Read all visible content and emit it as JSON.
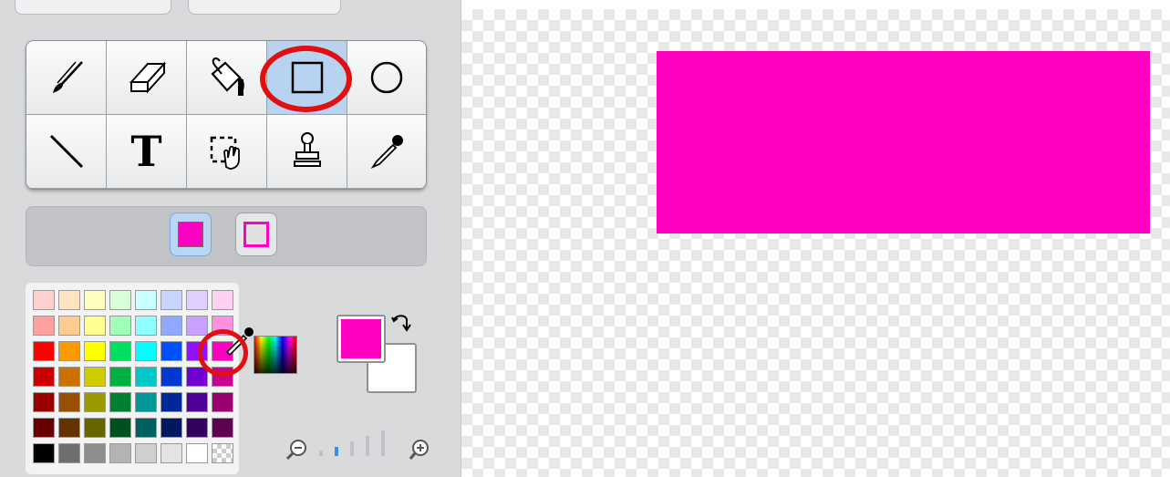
{
  "colors": {
    "fill": "#ff00c0",
    "secondary": "#ffffff",
    "panel": "#d9dadc",
    "annotation": "#e01010",
    "selected_tool": "#b8d3ef"
  },
  "tools": [
    [
      "brush-icon",
      "eraser-icon",
      "fill-bucket-icon",
      "rectangle-icon",
      "ellipse-icon"
    ],
    [
      "line-icon",
      "text-icon",
      "select-icon",
      "stamp-icon",
      "eyedropper-icon"
    ]
  ],
  "selected_tool": "rectangle-icon",
  "text_tool_label": "T",
  "fill_mode": {
    "selected": "solid",
    "options": [
      "solid",
      "outline"
    ]
  },
  "palette": [
    [
      "#ffd0d0",
      "#ffe4c0",
      "#ffffc0",
      "#d8ffd8",
      "#c8ffff",
      "#c8d4ff",
      "#e0d0ff",
      "#ffd0f0"
    ],
    [
      "#ffa0a0",
      "#ffcc90",
      "#ffff90",
      "#a0ffb8",
      "#90ffff",
      "#90a8ff",
      "#c8a0ff",
      "#ff90e0"
    ],
    [
      "#ff0000",
      "#ff9900",
      "#ffff00",
      "#00e060",
      "#00ffff",
      "#0050ff",
      "#9010ff",
      "#ff00c0"
    ],
    [
      "#cc0000",
      "#cc7000",
      "#cccc00",
      "#00b040",
      "#00c8c8",
      "#0038d0",
      "#7000d0",
      "#c80090"
    ],
    [
      "#990000",
      "#995000",
      "#999900",
      "#008030",
      "#009898",
      "#002898",
      "#500098",
      "#980070"
    ],
    [
      "#660000",
      "#663300",
      "#666600",
      "#005020",
      "#006060",
      "#001860",
      "#340060",
      "#600050"
    ],
    [
      "#000000",
      "#6e6e6e",
      "#8e8e8e",
      "#b4b4b4",
      "#d0d0d0",
      "#e4e4e4",
      "#ffffff",
      "checker"
    ]
  ],
  "zoom": {
    "levels": 5,
    "current_level": 2
  },
  "canvas": {
    "shape": "rectangle",
    "fill": "#ff00c0"
  }
}
